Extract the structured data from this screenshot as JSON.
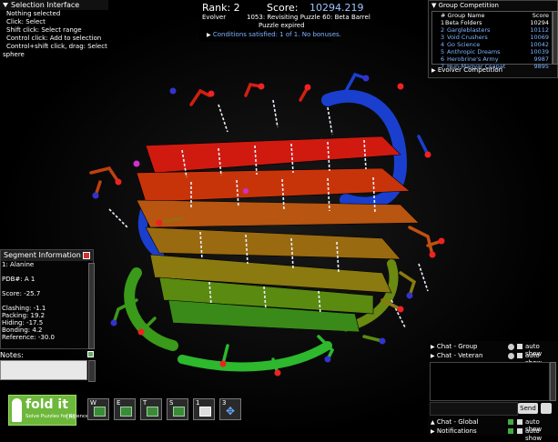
{
  "selection_panel": {
    "title": "Selection Interface",
    "lines": [
      "Nothing selected",
      "Click: Select",
      "Shift click: Select range",
      "Control click: Add to selection",
      "Control+shift click, drag: Select",
      "sphere"
    ]
  },
  "rank_panel": {
    "rank_label": "Rank: 2",
    "score_label": "Score:",
    "score_value": "10294.219",
    "role": "Evolver",
    "puzzle": "1053: Revisiting Puzzle 60: Beta Barrel",
    "status": "Puzzle expired",
    "conditions": "Conditions satisfied: 1 of 1. No bonuses."
  },
  "group_competition": {
    "title": "Group Competition",
    "col_name": "# Group Name",
    "col_score": "Score",
    "rows": [
      {
        "num": "1",
        "name": "Beta Folders",
        "score": "10294",
        "highlight": false
      },
      {
        "num": "2",
        "name": "Gargleblasters",
        "score": "10112",
        "highlight": true
      },
      {
        "num": "3",
        "name": "Void Crushers",
        "score": "10069",
        "highlight": true
      },
      {
        "num": "4",
        "name": "Go Science",
        "score": "10042",
        "highlight": true
      },
      {
        "num": "5",
        "name": "Anthropic Dreams",
        "score": "10039",
        "highlight": true
      },
      {
        "num": "6",
        "name": "Herobrine's Army",
        "score": "9987",
        "highlight": true
      },
      {
        "num": "7",
        "name": "Hun-Magyar Csapat",
        "score": "9895",
        "highlight": true
      }
    ],
    "evolver_title": "Evolver Competition"
  },
  "segment_info": {
    "title": "Segment Information",
    "lines": [
      "1: Alanine",
      "",
      "PDB#: A 1",
      "",
      "Score: -25.7",
      "",
      "Clashing: -1.1",
      "Packing: 19.2",
      "Hiding: -17.5",
      "Bonding: 4.2",
      "Reference: -30.0"
    ],
    "notes_label": "Notes:"
  },
  "chat": {
    "group": "Chat - Group",
    "veteran": "Chat - Veteran",
    "auto_show": "auto show",
    "send": "Send",
    "global": "Chat - Global",
    "notifications": "Notifications"
  },
  "logo": {
    "text": "fold it",
    "tagline": "Solve Puzzles for Science",
    "badge": "[H]"
  },
  "toolbar": [
    {
      "key": "W",
      "name": "wiggle"
    },
    {
      "key": "E",
      "name": "shake"
    },
    {
      "key": "T",
      "name": "tweak"
    },
    {
      "key": "S",
      "name": "sidechain"
    },
    {
      "key": "1",
      "name": "recipe"
    },
    {
      "key": "3",
      "name": "move"
    }
  ],
  "colors": {
    "accent_blue": "#7fb3ff",
    "highlight": "#8fbfff",
    "background": "#000000"
  }
}
